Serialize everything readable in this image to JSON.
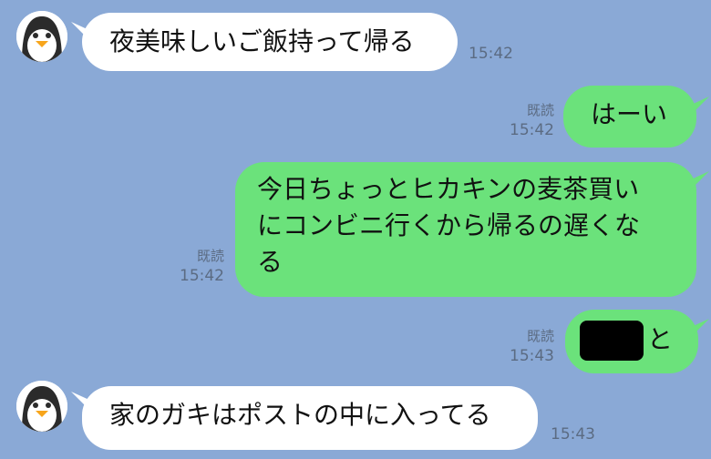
{
  "colors": {
    "background": "#8aa9d6",
    "incoming_bubble": "#ffffff",
    "outgoing_bubble": "#6be27b",
    "meta_text": "#5b6b82"
  },
  "messages": [
    {
      "direction": "incoming",
      "text": "夜美味しいご飯持って帰る",
      "time": "15:42",
      "read": ""
    },
    {
      "direction": "outgoing",
      "text": "はーい",
      "time": "15:42",
      "read": "既読"
    },
    {
      "direction": "outgoing",
      "text": "今日ちょっとヒカキンの麦茶買い\nにコンビニ行くから帰るの遅くな\nる",
      "time": "15:42",
      "read": "既読"
    },
    {
      "direction": "outgoing",
      "text": "と",
      "time": "15:43",
      "read": "既読",
      "redacted_prefix": true
    },
    {
      "direction": "incoming",
      "text": "家のガキはポストの中に入ってる",
      "time": "15:43",
      "read": ""
    }
  ],
  "sender": {
    "avatar_icon": "penguin-icon"
  }
}
